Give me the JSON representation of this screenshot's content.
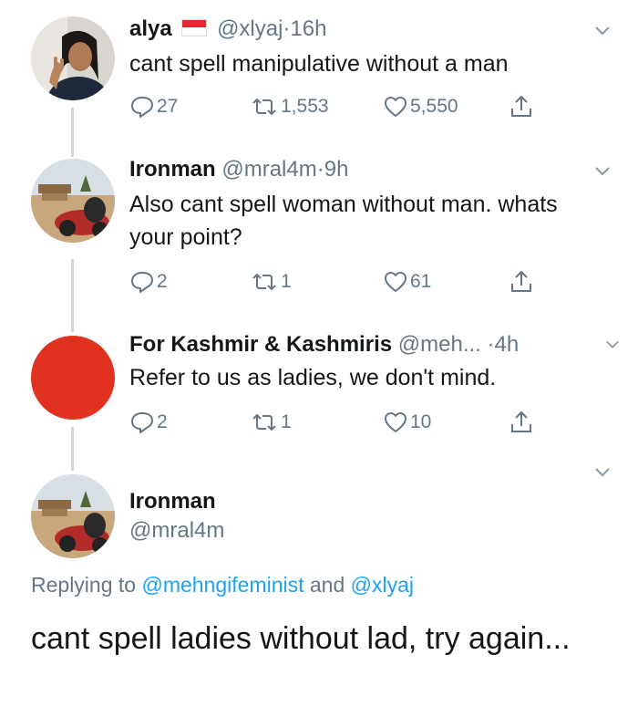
{
  "tweets": [
    {
      "name": "alya",
      "handle": "@xlyaj",
      "sep": "·",
      "time": "16h",
      "text": "cant spell manipulative without a man",
      "replies": "27",
      "retweets": "1,553",
      "likes": "5,550",
      "flag": "indonesia-flag"
    },
    {
      "name": "Ironman",
      "handle": "@mral4m",
      "sep": "·",
      "time": "9h",
      "text": "Also cant spell woman without man. whats your point?",
      "replies": "2",
      "retweets": "1",
      "likes": "61"
    },
    {
      "name": "For Kashmir & Kashmiris",
      "handle": "@meh...",
      "sep": "·",
      "time": "4h",
      "text": "Refer to us as ladies, we don't mind.",
      "replies": "2",
      "retweets": "1",
      "likes": "10",
      "avatar_color": "#e0321f"
    }
  ],
  "main_tweet": {
    "name": "Ironman",
    "handle": "@mral4m",
    "replying_prefix": "Replying to",
    "mention_1": "@mehngifeminist",
    "and_word": "and",
    "mention_2": "@xlyaj",
    "text": "cant spell ladies without lad, try again..."
  },
  "colors": {
    "text": "#14171a",
    "secondary": "#657786",
    "link": "#1da1f2",
    "thread_line": "#ccd6dd"
  },
  "icons": [
    "reply-icon",
    "retweet-icon",
    "like-icon",
    "share-icon",
    "chevron-down-icon"
  ]
}
